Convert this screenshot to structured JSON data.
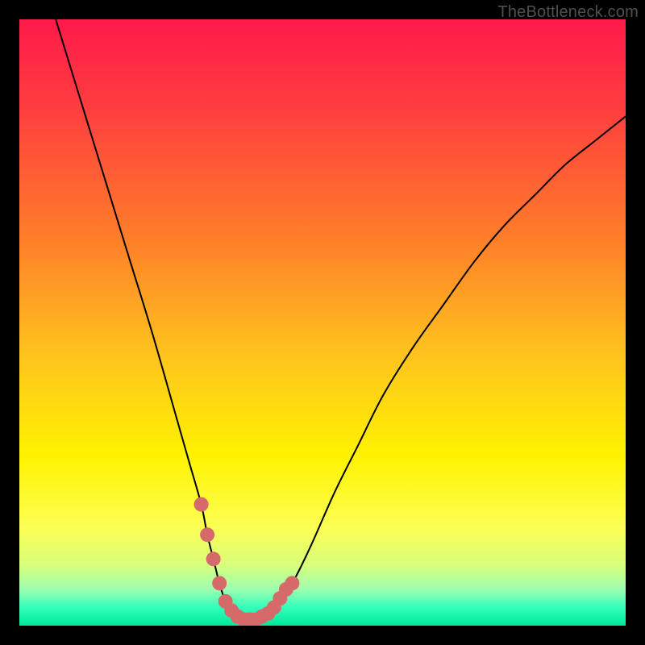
{
  "watermark": "TheBottleneck.com",
  "chart_data": {
    "type": "line",
    "title": "",
    "xlabel": "",
    "ylabel": "",
    "xlim": [
      0,
      100
    ],
    "ylim": [
      0,
      100
    ],
    "series": [
      {
        "name": "curve",
        "x": [
          6,
          10,
          14,
          18,
          22,
          26,
          28,
          30,
          31,
          32,
          33,
          34,
          35,
          36,
          37,
          38,
          40,
          42,
          45,
          48,
          52,
          56,
          60,
          65,
          70,
          75,
          80,
          85,
          90,
          95,
          100
        ],
        "y": [
          100,
          87,
          74,
          61,
          48,
          34,
          27,
          20,
          15,
          11,
          7,
          4,
          2.5,
          1.5,
          1,
          1,
          1.5,
          3,
          7,
          13,
          22,
          30,
          38,
          46,
          53,
          60,
          66,
          71,
          76,
          80,
          84
        ]
      }
    ],
    "markers": {
      "name": "highlight-dots",
      "color": "#d66a6a",
      "x": [
        30,
        31,
        32,
        33,
        34,
        35,
        36,
        37,
        38,
        39,
        40,
        41,
        42,
        43,
        44,
        45
      ],
      "y": [
        20,
        15,
        11,
        7,
        4,
        2.5,
        1.5,
        1,
        1,
        1,
        1.5,
        2,
        3,
        4.5,
        6,
        7
      ]
    },
    "gradient_stops": [
      {
        "offset": 0.0,
        "color": "#ff1a4a"
      },
      {
        "offset": 0.15,
        "color": "#ff3f3f"
      },
      {
        "offset": 0.35,
        "color": "#ff7a2a"
      },
      {
        "offset": 0.55,
        "color": "#ffc21e"
      },
      {
        "offset": 0.72,
        "color": "#fff200"
      },
      {
        "offset": 0.84,
        "color": "#fcff55"
      },
      {
        "offset": 0.9,
        "color": "#d8ff7a"
      },
      {
        "offset": 0.94,
        "color": "#9cffb0"
      },
      {
        "offset": 0.97,
        "color": "#33ffbb"
      },
      {
        "offset": 1.0,
        "color": "#00e89a"
      }
    ]
  }
}
